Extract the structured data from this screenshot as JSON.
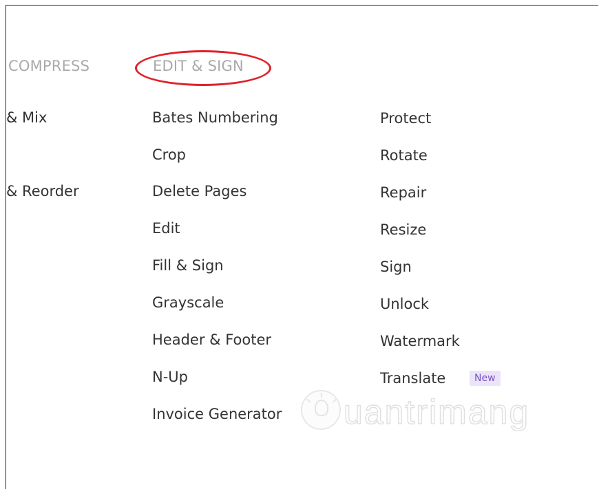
{
  "headings": {
    "compress": "COMPRESS",
    "edit_sign": "EDIT & SIGN"
  },
  "left_column": [
    "& Mix",
    "& Reorder"
  ],
  "edit_sign_column": [
    "Bates Numbering",
    "Crop",
    "Delete Pages",
    "Edit",
    "Fill & Sign",
    "Grayscale",
    "Header & Footer",
    "N-Up",
    "Invoice Generator"
  ],
  "right_column": [
    "Protect",
    "Rotate",
    "Repair",
    "Resize",
    "Sign",
    "Unlock",
    "Watermark",
    "Translate"
  ],
  "badge": {
    "label": "New",
    "text_color": "#7b52c9",
    "background": "#ebe4f8"
  },
  "highlight": {
    "color": "#e0212b"
  },
  "watermark": {
    "icon": "lightbulb-icon",
    "text": "uantrimang"
  }
}
